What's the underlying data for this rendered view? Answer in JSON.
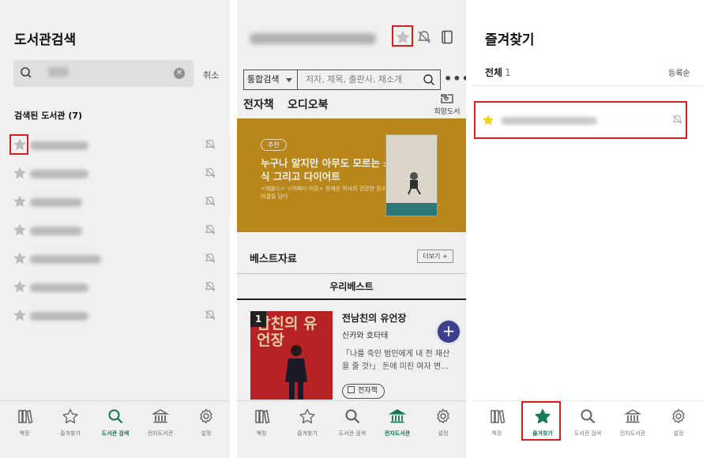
{
  "colors": {
    "accent": "#1a7a5a",
    "highlight_border": "#d21f1f",
    "banner_bg": "#c48f1d",
    "fav_star": "#f2d21c",
    "gray_star": "#c9c9c9"
  },
  "left_panel": {
    "title": "도서관검색",
    "search": {
      "icon": "search-icon",
      "clear_icon": "clear-icon"
    },
    "cancel_label": "취소",
    "results_title": "검색된 도서관 (7)",
    "libraries": [
      {
        "star_icon": "star-outline-icon",
        "bell_icon": "bell-off-icon"
      },
      {
        "star_icon": "star-outline-icon",
        "bell_icon": "bell-off-icon"
      },
      {
        "star_icon": "star-outline-icon",
        "bell_icon": "bell-off-icon"
      },
      {
        "star_icon": "star-outline-icon",
        "bell_icon": "bell-off-icon"
      },
      {
        "star_icon": "star-outline-icon",
        "bell_icon": "bell-off-icon"
      },
      {
        "star_icon": "star-outline-icon",
        "bell_icon": "bell-off-icon"
      },
      {
        "star_icon": "star-outline-icon",
        "bell_icon": "bell-off-icon"
      }
    ],
    "nav": [
      {
        "label": "책장",
        "icon": "bookshelf-icon",
        "active": false
      },
      {
        "label": "즐겨찾기",
        "icon": "star-icon",
        "active": false
      },
      {
        "label": "도서관 검색",
        "icon": "search-icon",
        "active": true
      },
      {
        "label": "전자도서관",
        "icon": "library-icon",
        "active": false
      },
      {
        "label": "설정",
        "icon": "gear-icon",
        "active": false
      }
    ]
  },
  "middle_panel": {
    "header_icons": [
      "star-icon",
      "bell-off-icon",
      "book-icon"
    ],
    "search": {
      "select_value": "통합검색",
      "placeholder": "저자, 제목, 출판사, 채소개"
    },
    "tabs": [
      "전자책",
      "오디오북"
    ],
    "wishlist_label": "희망도서",
    "banner": {
      "tag": "추천",
      "headline": "누구나 알지만 아무도 모르는 소식 그리고 다이어트",
      "subline": "<해블스> <어쩌다 어른> 창재운 약사의 건강한 장수 비결을 담다"
    },
    "best_title": "베스트자료",
    "more_label": "더보기 +",
    "best_tab": "우리베스트",
    "book": {
      "rank": "1",
      "cover_title": "남친의 유언장",
      "title": "전남친의 유언장",
      "author": "신카와 호타테",
      "description": "「나를 죽인 범인에게 내 전 재산을 줄 것!」 돈에 미친 여자 변…",
      "format": "전자책"
    },
    "nav": [
      {
        "label": "책장",
        "icon": "bookshelf-icon",
        "active": false
      },
      {
        "label": "즐겨찾기",
        "icon": "star-icon",
        "active": false
      },
      {
        "label": "도서관 검색",
        "icon": "search-icon",
        "active": false
      },
      {
        "label": "전자도서관",
        "icon": "library-icon",
        "active": true
      },
      {
        "label": "설정",
        "icon": "gear-icon",
        "active": false
      }
    ]
  },
  "right_panel": {
    "title": "즐겨찾기",
    "count_label": "전체",
    "count_value": "1",
    "order_label": "등록순",
    "favorite": {
      "star_icon": "star-filled-icon",
      "bell_icon": "bell-off-icon"
    },
    "nav": [
      {
        "label": "책장",
        "icon": "bookshelf-icon",
        "active": false
      },
      {
        "label": "즐겨찾기",
        "icon": "star-icon",
        "active": true
      },
      {
        "label": "도서관 검색",
        "icon": "search-icon",
        "active": false
      },
      {
        "label": "전자도서관",
        "icon": "library-icon",
        "active": false
      },
      {
        "label": "설정",
        "icon": "gear-icon",
        "active": false
      }
    ]
  }
}
